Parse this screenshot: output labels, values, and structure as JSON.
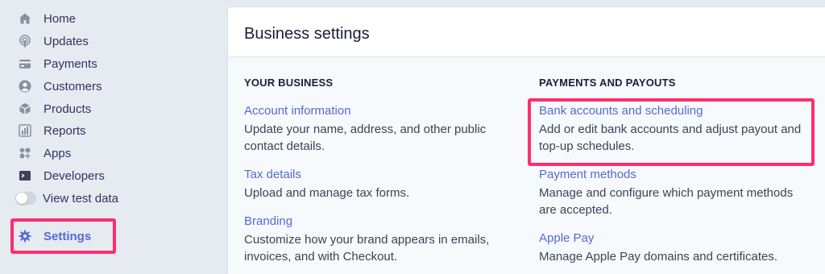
{
  "sidebar": {
    "items": [
      {
        "label": "Home",
        "icon": "home-icon"
      },
      {
        "label": "Updates",
        "icon": "broadcast-icon"
      },
      {
        "label": "Payments",
        "icon": "payments-icon"
      },
      {
        "label": "Customers",
        "icon": "user-icon"
      },
      {
        "label": "Products",
        "icon": "box-icon"
      },
      {
        "label": "Reports",
        "icon": "bar-chart-icon"
      },
      {
        "label": "Apps",
        "icon": "apps-icon"
      },
      {
        "label": "Developers",
        "icon": "terminal-icon"
      }
    ],
    "test_data": {
      "label": "View test data",
      "enabled": false
    },
    "settings": {
      "label": "Settings",
      "icon": "gear-icon",
      "active": true
    }
  },
  "panel": {
    "title": "Business settings",
    "sections": [
      {
        "title": "YOUR BUSINESS",
        "entries": [
          {
            "link": "Account information",
            "desc": "Update your name, address, and other public contact details."
          },
          {
            "link": "Tax details",
            "desc": "Upload and manage tax forms."
          },
          {
            "link": "Branding",
            "desc": "Customize how your brand appears in emails, invoices, and with Checkout."
          }
        ]
      },
      {
        "title": "PAYMENTS AND PAYOUTS",
        "entries": [
          {
            "link": "Bank accounts and scheduling",
            "desc": "Add or edit bank accounts and adjust payout and top-up schedules."
          },
          {
            "link": "Payment methods",
            "desc": "Manage and configure which payment methods are accepted."
          },
          {
            "link": "Apple Pay",
            "desc": "Manage Apple Pay domains and certificates."
          }
        ]
      }
    ]
  },
  "colors": {
    "background": "#e6ebf1",
    "accent": "#5469d4",
    "highlight": "#ff2d6f",
    "text": "#32325d"
  }
}
